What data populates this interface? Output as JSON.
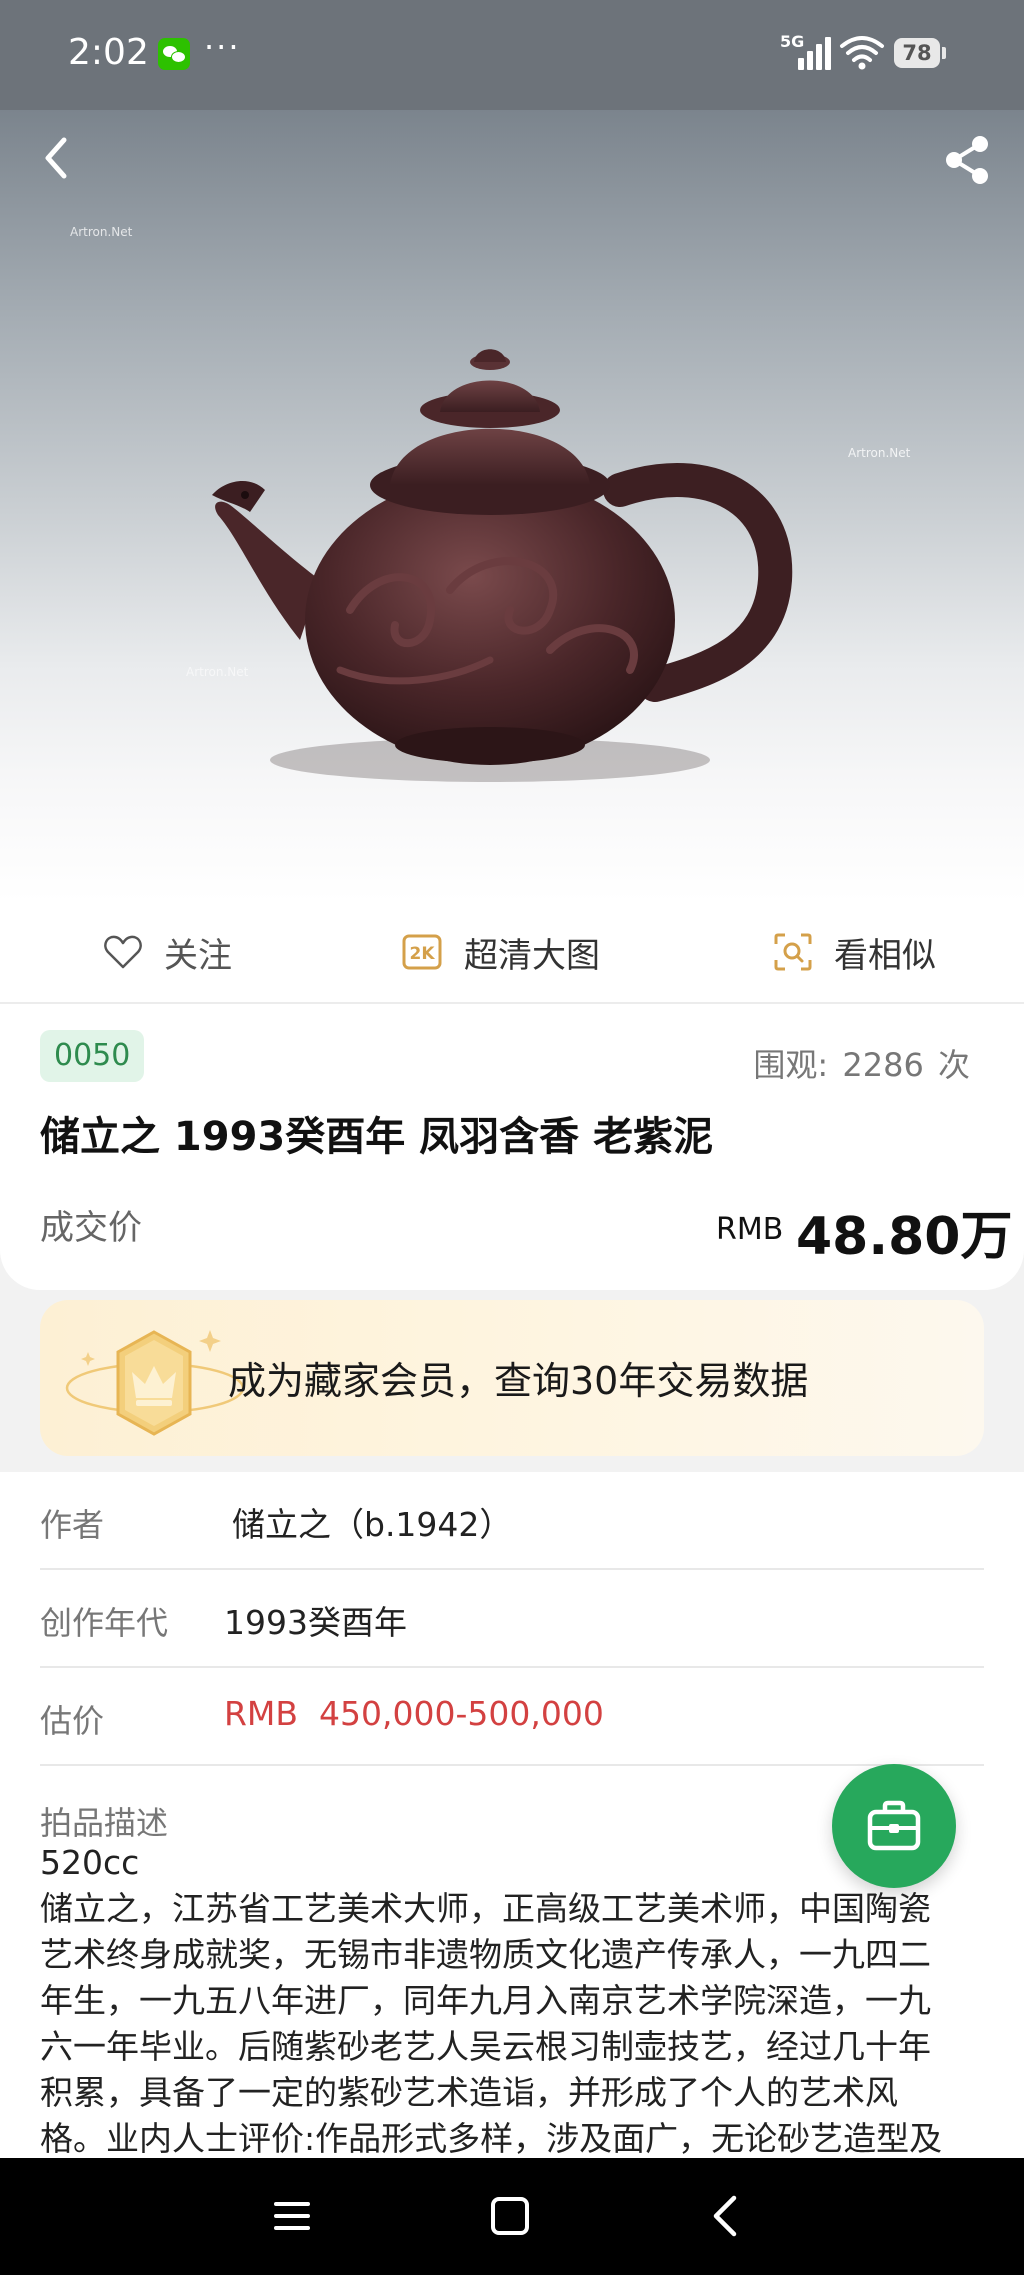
{
  "status_bar": {
    "time": "2:02",
    "dots": "···",
    "network": "5G",
    "battery": "78",
    "icons": [
      "wechat-icon",
      "signal-icon",
      "wifi-icon",
      "battery-icon"
    ]
  },
  "hero": {
    "watermark": "Artron.Net",
    "icons": [
      "back-icon",
      "share-icon"
    ]
  },
  "actions": {
    "follow": "关注",
    "hd_badge": "2K",
    "hd": "超清大图",
    "similar": "看相似"
  },
  "lot": {
    "number": "0050",
    "views_label": "围观:",
    "views_count": "2286",
    "views_unit": "次",
    "title": "储立之 1993癸酉年 凤羽含香 老紫泥",
    "price_label": "成交价",
    "price_currency": "RMB",
    "price_value": "48.80万"
  },
  "vip_banner": {
    "text": "成为藏家会员，查询30年交易数据"
  },
  "details": {
    "author_label": "作者",
    "author_value": "储立之（b.1942）",
    "year_label": "创作年代",
    "year_value": "1993癸酉年",
    "estimate_label": "估价",
    "estimate_value": "RMB  450,000-500,000",
    "description_label": "拍品描述",
    "description": "520cc\n储立之，江苏省工艺美术大师，正高级工艺美术师，中国陶瓷\n艺术终身成就奖，无锡市非遗物质文化遗产传承人，一九四二\n年生，一九五八年进厂，同年九月入南京艺术学院深造，一九\n六一年毕业。后随紫砂老艺人吴云根习制壶技艺，经过几十年\n积累，具备了一定的紫砂艺术造诣，并形成了个人的艺术风\n格。业内人士评价:作品形式多样，涉及面广，无论砂艺造型及"
  },
  "colors": {
    "accent_green": "#27a85c",
    "estimate_red": "#d34141",
    "badge_bg": "#e1f4e8"
  }
}
